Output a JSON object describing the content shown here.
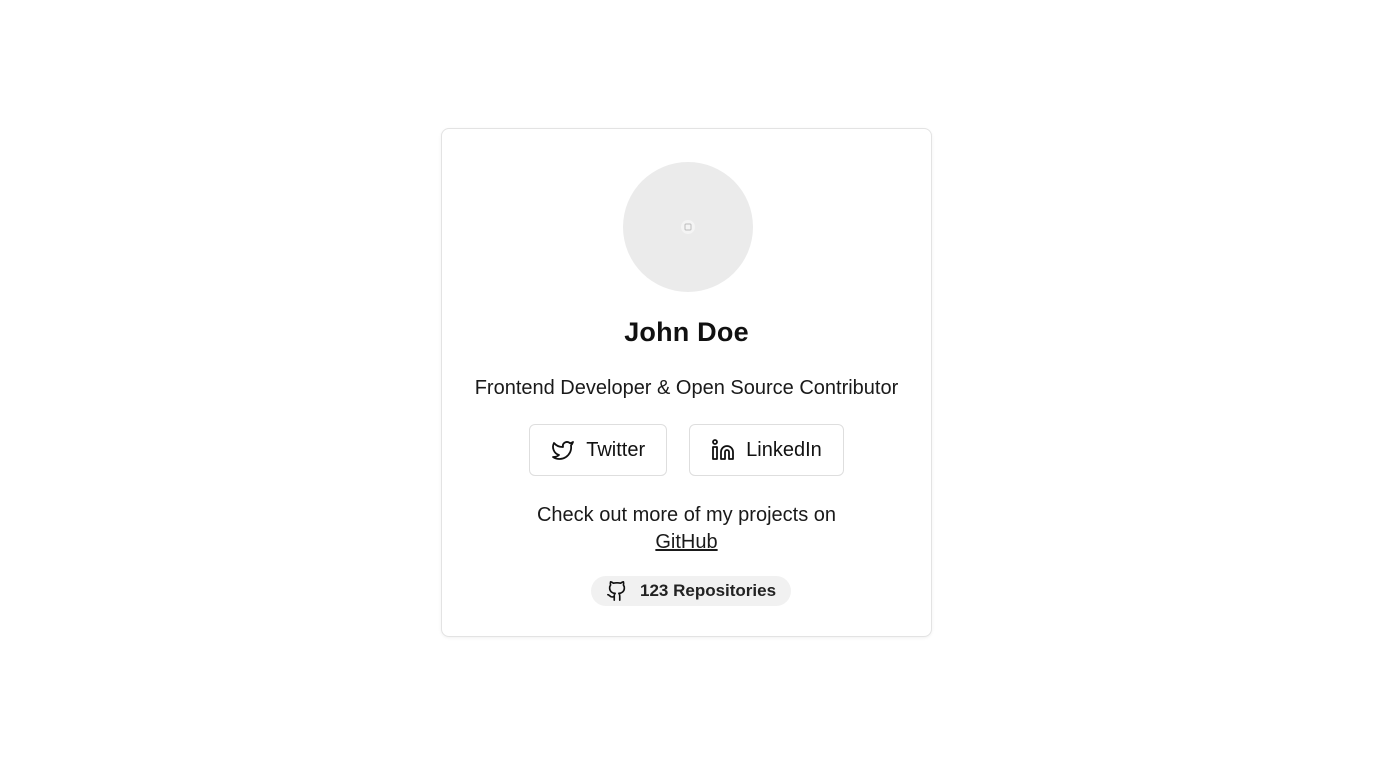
{
  "profile": {
    "name": "John Doe",
    "bio": "Frontend Developer & Open Source Contributor"
  },
  "social": {
    "twitter_label": "Twitter",
    "twitter_icon": "twitter-icon",
    "linkedin_label": "LinkedIn",
    "linkedin_icon": "linkedin-icon"
  },
  "github": {
    "prompt": "Check out more of my projects on",
    "link_label": "GitHub",
    "repos_label": "123 Repositories",
    "repos_icon": "github-icon"
  },
  "colors": {
    "avatar_bg": "#ebebeb",
    "badge_bg": "#f1f1f1",
    "border": "#dedede"
  }
}
